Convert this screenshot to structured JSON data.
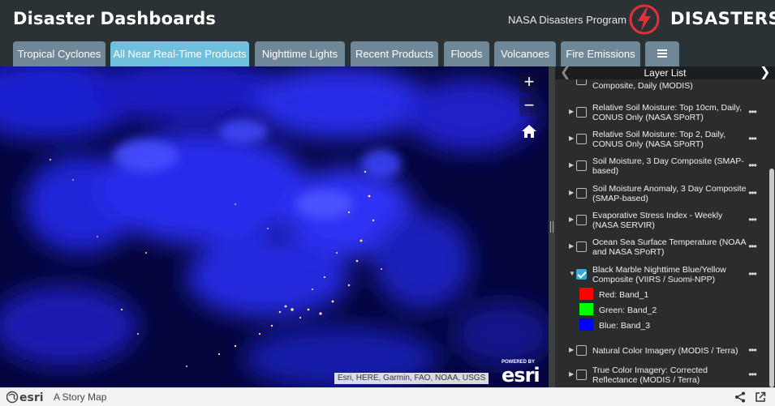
{
  "header": {
    "title": "Disaster Dashboards",
    "program": "NASA Disasters Program",
    "logo_text": "DISASTERS"
  },
  "tabs": [
    {
      "label": "Tropical Cyclones",
      "active": false
    },
    {
      "label": "All Near Real-Time Products",
      "active": true
    },
    {
      "label": "Nighttime Lights",
      "active": false
    },
    {
      "label": "Recent Products",
      "active": false
    },
    {
      "label": "Floods",
      "active": false
    },
    {
      "label": "Volcanoes",
      "active": false
    },
    {
      "label": "Fire Emissions",
      "active": false
    }
  ],
  "tab_menu_icon": "hamburger-menu-icon",
  "map": {
    "zoom_in": "+",
    "zoom_out": "−",
    "home_icon": "home-icon",
    "powered_by": "POWERED BY",
    "esri": "esri",
    "attribution": "Esri, HERE, Garmin, FAO, NOAA, USGS"
  },
  "layer_list": {
    "title": "Layer List",
    "layers": [
      {
        "name": "Composite, Daily (MODIS)",
        "checked": false,
        "expanded": false
      },
      {
        "name": "Relative Soil Moisture: Top 10cm, Daily, CONUS Only (NASA SPoRT)",
        "checked": false,
        "expanded": false
      },
      {
        "name": "Relative Soil Moisture: Top 2, Daily, CONUS Only (NASA SPoRT)",
        "checked": false,
        "expanded": false
      },
      {
        "name": "Soil Moisture, 3 Day Composite (SMAP-based)",
        "checked": false,
        "expanded": false
      },
      {
        "name": "Soil Moisture Anomaly, 3 Day Composite (SMAP-based)",
        "checked": false,
        "expanded": false
      },
      {
        "name": "Evaporative Stress Index - Weekly (NASA SERVIR)",
        "checked": false,
        "expanded": false
      },
      {
        "name": "Ocean Sea Surface Temperature (NOAA and NASA SPoRT)",
        "checked": false,
        "expanded": false
      },
      {
        "name": "Black Marble Nighttime Blue/Yellow Composite (VIIRS / Suomi-NPP)",
        "checked": true,
        "expanded": true
      },
      {
        "name": "Natural Color Imagery (MODIS / Terra)",
        "checked": false,
        "expanded": false
      },
      {
        "name": "True Color Imagery: Corrected Reflectance (MODIS / Terra)",
        "checked": false,
        "expanded": false
      }
    ],
    "legend": [
      {
        "label": "Red: Band_1",
        "color": "#ff0000"
      },
      {
        "label": "Green: Band_2",
        "color": "#00ff00"
      },
      {
        "label": "Blue: Band_3",
        "color": "#0000ff"
      }
    ],
    "more_glyph": "•••"
  },
  "footer": {
    "logo": "esri",
    "story": "A Story Map"
  }
}
